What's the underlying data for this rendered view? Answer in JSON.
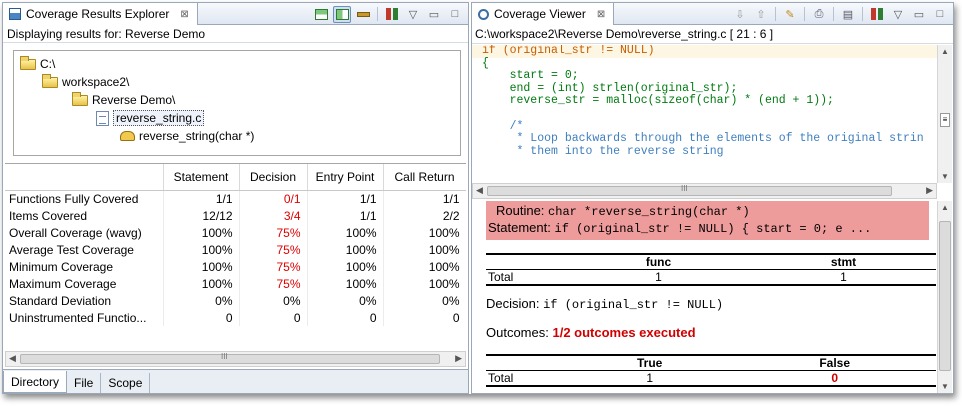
{
  "left_pane": {
    "tab_title": "Coverage Results Explorer",
    "tab_close": "⊠",
    "subtitle": "Displaying results for: Reverse Demo",
    "tree": [
      "C:\\",
      "workspace2\\",
      "Reverse Demo\\",
      "reverse_string.c",
      "reverse_string(char *)"
    ],
    "columns": [
      "",
      "Statement",
      "Decision",
      "Entry Point",
      "Call Return"
    ],
    "rows": [
      {
        "label": "Functions Fully Covered",
        "cells": [
          "1/1",
          "0/1",
          "1/1",
          "1/1"
        ],
        "red": [
          false,
          true,
          false,
          false
        ]
      },
      {
        "label": "Items Covered",
        "cells": [
          "12/12",
          "3/4",
          "1/1",
          "2/2"
        ],
        "red": [
          false,
          true,
          false,
          false
        ]
      },
      {
        "label": "Overall Coverage (wavg)",
        "cells": [
          "100%",
          "75%",
          "100%",
          "100%"
        ],
        "red": [
          false,
          true,
          false,
          false
        ]
      },
      {
        "label": "Average Test Coverage",
        "cells": [
          "100%",
          "75%",
          "100%",
          "100%"
        ],
        "red": [
          false,
          true,
          false,
          false
        ]
      },
      {
        "label": "Minimum Coverage",
        "cells": [
          "100%",
          "75%",
          "100%",
          "100%"
        ],
        "red": [
          false,
          true,
          false,
          false
        ]
      },
      {
        "label": "Maximum Coverage",
        "cells": [
          "100%",
          "75%",
          "100%",
          "100%"
        ],
        "red": [
          false,
          true,
          false,
          false
        ]
      },
      {
        "label": "Standard Deviation",
        "cells": [
          "0%",
          "0%",
          "0%",
          "0%"
        ],
        "red": [
          false,
          false,
          false,
          false
        ]
      },
      {
        "label": "Uninstrumented Functio...",
        "cells": [
          "0",
          "0",
          "0",
          "0"
        ],
        "red": [
          false,
          false,
          false,
          false
        ]
      }
    ],
    "scroll_marker": "III",
    "bottom_tabs": [
      "Directory",
      "File",
      "Scope"
    ]
  },
  "right_pane": {
    "tab_title": "Coverage Viewer",
    "tab_close": "⊠",
    "path": "C:\\workspace2\\Reverse Demo\\reverse_string.c [ 21 : 6 ]",
    "code_lines": [
      "if (original_str != NULL)",
      "{",
      "    start = 0;",
      "    end = (int) strlen(original_str);",
      "    reverse_str = malloc(sizeof(char) * (end + 1));",
      "",
      "    /*",
      "     * Loop backwards through the elements of the original strin",
      "     * them into the reverse string"
    ],
    "scroll_marker": "III",
    "report": {
      "routine_label": "Routine:",
      "routine_value": "char *reverse_string(char *)",
      "statement_label": "Statement:",
      "statement_value": "if (original_str != NULL) { start = 0; e ...",
      "table1": {
        "headers": [
          "",
          "func",
          "stmt"
        ],
        "row_label": "Total",
        "values": [
          "1",
          "1"
        ]
      },
      "decision_label": "Decision:",
      "decision_value": "if (original_str != NULL)",
      "outcomes_label": "Outcomes:",
      "outcomes_value": "1/2 outcomes executed",
      "table2": {
        "headers": [
          "",
          "True",
          "False"
        ],
        "row_label": "Total",
        "values": [
          "1",
          "0"
        ]
      }
    }
  },
  "colors": {
    "red": "#e00000",
    "highlight_box": "#ee9b9b",
    "code_keyword": "#c75d00",
    "code_body": "#007a10",
    "code_comment": "#3f7fbf"
  }
}
